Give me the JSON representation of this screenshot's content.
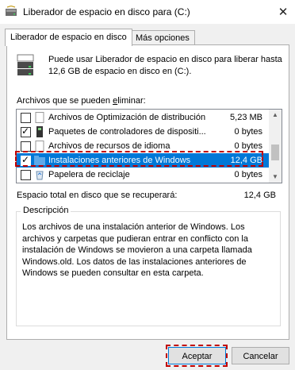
{
  "window": {
    "title": "Liberador de espacio en disco para  (C:)",
    "close_glyph": "✕"
  },
  "tabs": [
    {
      "label": "Liberador de espacio en disco",
      "active": true
    },
    {
      "label": "Más opciones",
      "active": false
    }
  ],
  "info": {
    "text": "Puede usar Liberador de espacio en disco para liberar hasta 12,6 GB de espacio en disco en  (C:)."
  },
  "files": {
    "label_prefix": "Archivos que se pueden ",
    "label_underlined": "e",
    "label_suffix": "liminar:",
    "items": [
      {
        "name": "Archivos de Optimización de distribución",
        "size": "5,23 MB",
        "checked": false,
        "icon": "blank-file-icon",
        "selected": false
      },
      {
        "name": "Paquetes de controladores de dispositi...",
        "size": "0 bytes",
        "checked": true,
        "icon": "driver-package-icon",
        "selected": false
      },
      {
        "name": "Archivos de recursos de idioma",
        "size": "0 bytes",
        "checked": false,
        "icon": "blank-file-icon",
        "selected": false
      },
      {
        "name": "Instalaciones anteriores de Windows",
        "size": "12,4 GB",
        "checked": true,
        "icon": "windows-folder-icon",
        "selected": true
      },
      {
        "name": "Papelera de reciclaje",
        "size": "0 bytes",
        "checked": false,
        "icon": "recycle-bin-icon",
        "selected": false
      }
    ]
  },
  "total": {
    "label": "Espacio total en disco que se recuperará:",
    "value": "12,4 GB"
  },
  "description": {
    "title": "Descripción",
    "text": "Los archivos de una instalación anterior de Windows. Los archivos y carpetas que pudieran entrar en conflicto con la instalación de Windows se movieron a una carpeta llamada Windows.old. Los datos de las instalaciones anteriores de Windows se pueden consultar en esta carpeta."
  },
  "buttons": {
    "ok": "Aceptar",
    "cancel": "Cancelar"
  },
  "colors": {
    "selection": "#0078d7",
    "highlight": "#c00000"
  }
}
